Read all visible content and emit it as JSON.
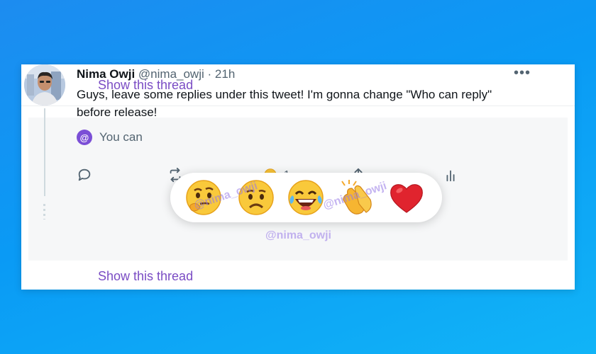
{
  "thread_link_top": "Show this thread",
  "thread_link_bottom": "Show this thread",
  "tweet": {
    "name": "Nima Owji",
    "handle": "@nima_owji",
    "separator": "·",
    "time": "21h",
    "text": "Guys, leave some replies under this tweet! I'm gonna change \"Who can reply\" before release!",
    "reply_restriction": "You can",
    "reply_badge": "@",
    "retweet_count": "1"
  },
  "reactions": [
    {
      "name": "thinking-face-emoji"
    },
    {
      "name": "frowning-face-emoji"
    },
    {
      "name": "tears-of-joy-emoji"
    },
    {
      "name": "clapping-hands-emoji"
    },
    {
      "name": "red-heart-emoji"
    }
  ],
  "watermark_text": "@nima_owji",
  "colors": {
    "background_start": "#1d8cf0",
    "background_end": "#11b4f7",
    "link": "#7a4cc4",
    "badge": "#7b4fd6",
    "icon": "#536471"
  }
}
